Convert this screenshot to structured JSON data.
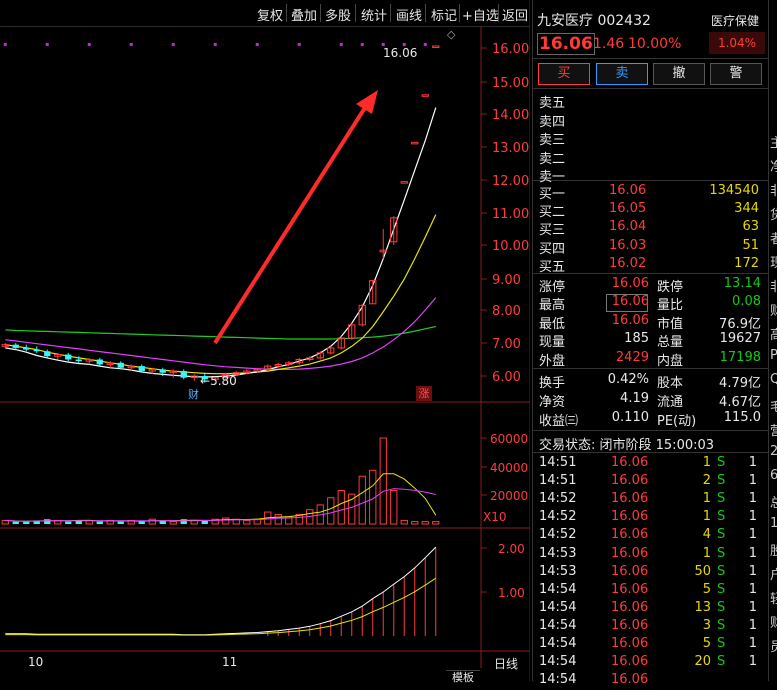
{
  "toolbar": {
    "items": [
      "复权",
      "叠加",
      "多股",
      "统计",
      "画线",
      "标记",
      "+自选",
      "返回"
    ]
  },
  "price_axis": [
    "16.00",
    "15.00",
    "14.00",
    "13.00",
    "12.00",
    "11.00",
    "10.00",
    "9.00",
    "8.00",
    "7.00",
    "6.00"
  ],
  "volume_axis": [
    "60000",
    "40000",
    "20000"
  ],
  "volume_unit": "X10",
  "indicator_axis": [
    "2.00",
    "1.00"
  ],
  "date_axis": [
    "10",
    "11"
  ],
  "date_mode": "日线",
  "chart_annotations": {
    "high_label": "16.06",
    "low_label": "5.80",
    "cai_marker": "财",
    "zhang_marker": "涨"
  },
  "bottom_tab": "模板",
  "colors": {
    "up": "#ff3b3b",
    "down": "#39f5f5",
    "ma5": "#ffffff",
    "ma10": "#e6e600",
    "ma20": "#e040fb",
    "ma60": "#22cc22",
    "arrow": "#ff2a2a",
    "dots": "#d020d0"
  },
  "stock": {
    "name": "九安医疗",
    "code": "002432",
    "sector": "医疗保健",
    "sector_change": "1.04%",
    "price": "16.06",
    "change": "1.46",
    "change_pct": "10.00%"
  },
  "trade_buttons": [
    "买",
    "卖",
    "撤",
    "警"
  ],
  "sell_levels": [
    {
      "label": "卖五"
    },
    {
      "label": "卖四"
    },
    {
      "label": "卖三"
    },
    {
      "label": "卖二"
    },
    {
      "label": "卖一"
    }
  ],
  "buy_levels": [
    {
      "label": "买一",
      "price": "16.06",
      "vol": "134540"
    },
    {
      "label": "买二",
      "price": "16.05",
      "vol": "344"
    },
    {
      "label": "买三",
      "price": "16.04",
      "vol": "63"
    },
    {
      "label": "买四",
      "price": "16.03",
      "vol": "51"
    },
    {
      "label": "买五",
      "price": "16.02",
      "vol": "172"
    }
  ],
  "stats": {
    "zhangting_label": "涨停",
    "zhangting": "16.06",
    "dieting_label": "跌停",
    "dieting": "13.14",
    "zuigao_label": "最高",
    "zuigao": "16.06",
    "liangbi_label": "量比",
    "liangbi": "0.08",
    "zuidi_label": "最低",
    "zuidi": "16.06",
    "shizhi_label": "市值",
    "shizhi": "76.9亿",
    "xianliang_label": "现量",
    "xianliang": "185",
    "zongliang_label": "总量",
    "zongliang": "19627",
    "waipan_label": "外盘",
    "waipan": "2429",
    "neipan_label": "内盘",
    "neipan": "17198",
    "huanshou_label": "换手",
    "huanshou": "0.42%",
    "guben_label": "股本",
    "guben": "4.79亿",
    "jingzi_label": "净资",
    "jingzi": "4.19",
    "liutong_label": "流通",
    "liutong": "4.67亿",
    "shouyi_label": "收益㈢",
    "shouyi": "0.110",
    "pe_label": "PE(动)",
    "pe": "115.0"
  },
  "trade_status": "交易状态: 闭市阶段 15:00:03",
  "ticks": [
    {
      "time": "14:51",
      "price": "16.06",
      "vol": "1",
      "dir": "S",
      "n": "1"
    },
    {
      "time": "14:51",
      "price": "16.06",
      "vol": "2",
      "dir": "S",
      "n": "1"
    },
    {
      "time": "14:52",
      "price": "16.06",
      "vol": "1",
      "dir": "S",
      "n": "1"
    },
    {
      "time": "14:52",
      "price": "16.06",
      "vol": "1",
      "dir": "S",
      "n": "1"
    },
    {
      "time": "14:52",
      "price": "16.06",
      "vol": "4",
      "dir": "S",
      "n": "1"
    },
    {
      "time": "14:53",
      "price": "16.06",
      "vol": "1",
      "dir": "S",
      "n": "1"
    },
    {
      "time": "14:53",
      "price": "16.06",
      "vol": "50",
      "dir": "S",
      "n": "1"
    },
    {
      "time": "14:54",
      "price": "16.06",
      "vol": "5",
      "dir": "S",
      "n": "1"
    },
    {
      "time": "14:54",
      "price": "16.06",
      "vol": "13",
      "dir": "S",
      "n": "1"
    },
    {
      "time": "14:54",
      "price": "16.06",
      "vol": "3",
      "dir": "S",
      "n": "1"
    },
    {
      "time": "14:54",
      "price": "16.06",
      "vol": "5",
      "dir": "S",
      "n": "1"
    },
    {
      "time": "14:54",
      "price": "16.06",
      "vol": "20",
      "dir": "S",
      "n": "1"
    },
    {
      "time": "14:54",
      "price": "16.06",
      "vol": "",
      "dir": "",
      "n": ""
    }
  ],
  "edge_chars": [
    "主",
    "净",
    "非",
    "货",
    "者",
    "现",
    "非",
    "财",
    "高",
    "P",
    "Q",
    "毛",
    "营",
    "2",
    "6",
    "总",
    "1",
    "股",
    "户",
    "轻",
    "财",
    "员"
  ],
  "candles": {
    "ohlc": [
      [
        6.9,
        7.0,
        6.85,
        6.95
      ],
      [
        6.95,
        7.0,
        6.8,
        6.85
      ],
      [
        6.85,
        6.95,
        6.75,
        6.8
      ],
      [
        6.8,
        6.9,
        6.7,
        6.75
      ],
      [
        6.75,
        6.8,
        6.55,
        6.6
      ],
      [
        6.6,
        6.7,
        6.5,
        6.65
      ],
      [
        6.65,
        6.7,
        6.45,
        6.5
      ],
      [
        6.5,
        6.6,
        6.4,
        6.45
      ],
      [
        6.45,
        6.55,
        6.35,
        6.5
      ],
      [
        6.5,
        6.55,
        6.3,
        6.35
      ],
      [
        6.35,
        6.45,
        6.25,
        6.4
      ],
      [
        6.4,
        6.45,
        6.2,
        6.25
      ],
      [
        6.25,
        6.35,
        6.15,
        6.3
      ],
      [
        6.3,
        6.35,
        6.1,
        6.15
      ],
      [
        6.15,
        6.25,
        6.05,
        6.2
      ],
      [
        6.2,
        6.25,
        6.0,
        6.1
      ],
      [
        6.1,
        6.2,
        5.95,
        6.15
      ],
      [
        6.15,
        6.2,
        5.9,
        5.95
      ],
      [
        5.95,
        6.05,
        5.85,
        6.0
      ],
      [
        6.0,
        6.1,
        5.8,
        5.9
      ],
      [
        5.9,
        6.0,
        5.85,
        5.95
      ],
      [
        5.95,
        6.1,
        5.9,
        6.05
      ],
      [
        6.05,
        6.15,
        6.0,
        6.1
      ],
      [
        6.1,
        6.2,
        6.05,
        6.15
      ],
      [
        6.15,
        6.25,
        6.1,
        6.2
      ],
      [
        6.2,
        6.35,
        6.15,
        6.3
      ],
      [
        6.3,
        6.4,
        6.25,
        6.35
      ],
      [
        6.35,
        6.45,
        6.3,
        6.4
      ],
      [
        6.4,
        6.55,
        6.35,
        6.5
      ],
      [
        6.5,
        6.6,
        6.45,
        6.55
      ],
      [
        6.55,
        6.75,
        6.5,
        6.7
      ],
      [
        6.7,
        6.9,
        6.65,
        6.85
      ],
      [
        6.85,
        7.2,
        6.8,
        7.15
      ],
      [
        7.15,
        7.6,
        7.1,
        7.55
      ],
      [
        7.55,
        8.2,
        7.5,
        8.15
      ],
      [
        8.2,
        8.95,
        8.2,
        8.95
      ],
      [
        9.8,
        10.5,
        9.6,
        9.85
      ],
      [
        10.1,
        10.9,
        10.0,
        10.85
      ],
      [
        11.95,
        11.95,
        11.95,
        11.95
      ],
      [
        13.14,
        13.14,
        13.14,
        13.14
      ],
      [
        14.6,
        14.6,
        14.6,
        14.6
      ],
      [
        16.06,
        16.06,
        16.06,
        16.06
      ]
    ],
    "ma5": [
      6.85,
      6.8,
      6.72,
      6.62,
      6.55,
      6.48,
      6.42,
      6.38,
      6.35,
      6.3,
      6.25,
      6.22,
      6.18,
      6.12,
      6.08,
      6.05,
      6.02,
      6.0,
      5.98,
      5.97,
      5.98,
      6.0,
      6.03,
      6.08,
      6.12,
      6.2,
      6.28,
      6.35,
      6.45,
      6.55,
      6.7,
      6.9,
      7.2,
      7.6,
      8.1,
      8.8,
      9.6,
      10.5,
      11.4,
      12.3,
      13.2,
      14.2
    ],
    "ma10": [
      6.95,
      6.9,
      6.85,
      6.8,
      6.72,
      6.66,
      6.6,
      6.55,
      6.5,
      6.45,
      6.4,
      6.35,
      6.3,
      6.26,
      6.22,
      6.18,
      6.15,
      6.12,
      6.1,
      6.08,
      6.07,
      6.07,
      6.08,
      6.1,
      6.12,
      6.15,
      6.2,
      6.25,
      6.3,
      6.36,
      6.45,
      6.55,
      6.7,
      6.9,
      7.15,
      7.5,
      7.95,
      8.45,
      9.0,
      9.6,
      10.25,
      10.95
    ],
    "ma20": [
      7.1,
      7.06,
      7.02,
      6.98,
      6.94,
      6.9,
      6.86,
      6.82,
      6.78,
      6.74,
      6.7,
      6.66,
      6.62,
      6.58,
      6.54,
      6.5,
      6.46,
      6.42,
      6.38,
      6.34,
      6.31,
      6.28,
      6.26,
      6.24,
      6.22,
      6.21,
      6.2,
      6.2,
      6.21,
      6.23,
      6.26,
      6.3,
      6.36,
      6.44,
      6.55,
      6.7,
      6.88,
      7.1,
      7.35,
      7.65,
      8.0,
      8.4
    ],
    "ma60": [
      7.4,
      7.38,
      7.37,
      7.36,
      7.35,
      7.34,
      7.33,
      7.32,
      7.31,
      7.3,
      7.29,
      7.28,
      7.27,
      7.26,
      7.25,
      7.24,
      7.23,
      7.22,
      7.21,
      7.2,
      7.19,
      7.18,
      7.17,
      7.16,
      7.15,
      7.14,
      7.13,
      7.12,
      7.12,
      7.12,
      7.12,
      7.12,
      7.13,
      7.14,
      7.16,
      7.18,
      7.21,
      7.25,
      7.3,
      7.36,
      7.43,
      7.5
    ],
    "vol": [
      3,
      2,
      2,
      3,
      4,
      3,
      2,
      3,
      3,
      2,
      3,
      2,
      3,
      2,
      4,
      3,
      2,
      4,
      3,
      3,
      4,
      5,
      4,
      3,
      4,
      10,
      8,
      6,
      8,
      12,
      16,
      22,
      28,
      25,
      40,
      45,
      72,
      28,
      3,
      2,
      2,
      2
    ],
    "ind": [
      0.05,
      0.05,
      0.05,
      0.04,
      0.04,
      0.04,
      0.04,
      0.04,
      0.04,
      0.04,
      0.04,
      0.04,
      0.04,
      0.04,
      0.04,
      0.04,
      0.04,
      0.03,
      0.03,
      0.03,
      0.04,
      0.05,
      0.06,
      0.07,
      0.08,
      0.1,
      0.12,
      0.15,
      0.18,
      0.22,
      0.28,
      0.35,
      0.45,
      0.55,
      0.68,
      0.85,
      1.0,
      1.18,
      1.35,
      1.55,
      1.78,
      2.02
    ]
  }
}
